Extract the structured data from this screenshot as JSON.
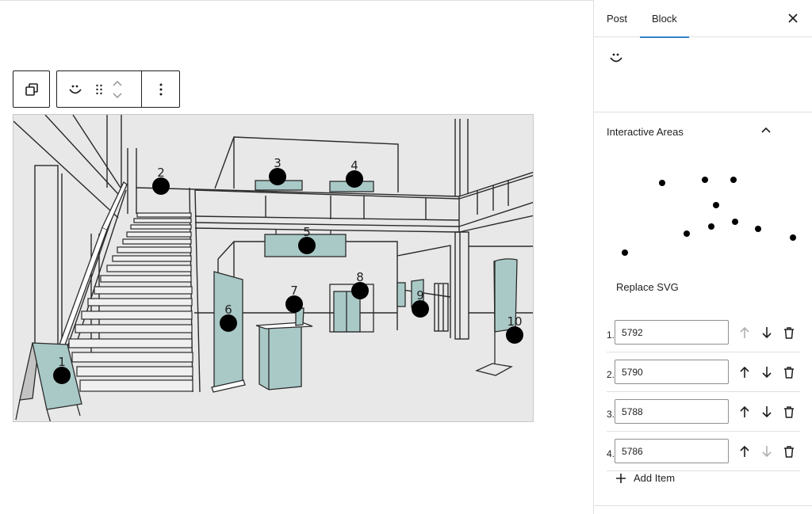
{
  "toolbar": {
    "transform_icon": "block-transform-icon",
    "block_icon": "smiley-icon",
    "drag_icon": "drag-handle-icon",
    "move_icon": "move-up-down-icon",
    "options_icon": "more-vertical-icon"
  },
  "figure": {
    "description": "Lobby illustration with numbered interactive hotspots",
    "hotspots": [
      {
        "label": "1"
      },
      {
        "label": "2"
      },
      {
        "label": "3"
      },
      {
        "label": "4"
      },
      {
        "label": "5"
      },
      {
        "label": "6"
      },
      {
        "label": "7"
      },
      {
        "label": "8"
      },
      {
        "label": "9"
      },
      {
        "label": "10"
      }
    ]
  },
  "sidebar": {
    "tabs": [
      {
        "label": "Post",
        "active": false
      },
      {
        "label": "Block",
        "active": true
      }
    ],
    "close_icon": "close-icon",
    "block_card_icon": "smiley-icon",
    "panel": {
      "title": "Interactive Areas",
      "expanded": true,
      "chevron_icon": "chevron-up-icon"
    },
    "replace_svg_label": "Replace SVG",
    "items": [
      {
        "number": "1.",
        "value": "5792",
        "up_enabled": false,
        "down_enabled": true
      },
      {
        "number": "2.",
        "value": "5790",
        "up_enabled": true,
        "down_enabled": true
      },
      {
        "number": "3.",
        "value": "5788",
        "up_enabled": true,
        "down_enabled": true
      },
      {
        "number": "4.",
        "value": "5786",
        "up_enabled": true,
        "down_enabled": false
      }
    ],
    "add_item_label": "Add Item",
    "colors": {
      "accent": "#3582c4",
      "disabled": "#a7a7a7",
      "text": "#1e1e1e",
      "hotspot_fill": "#a9c9c7"
    }
  }
}
